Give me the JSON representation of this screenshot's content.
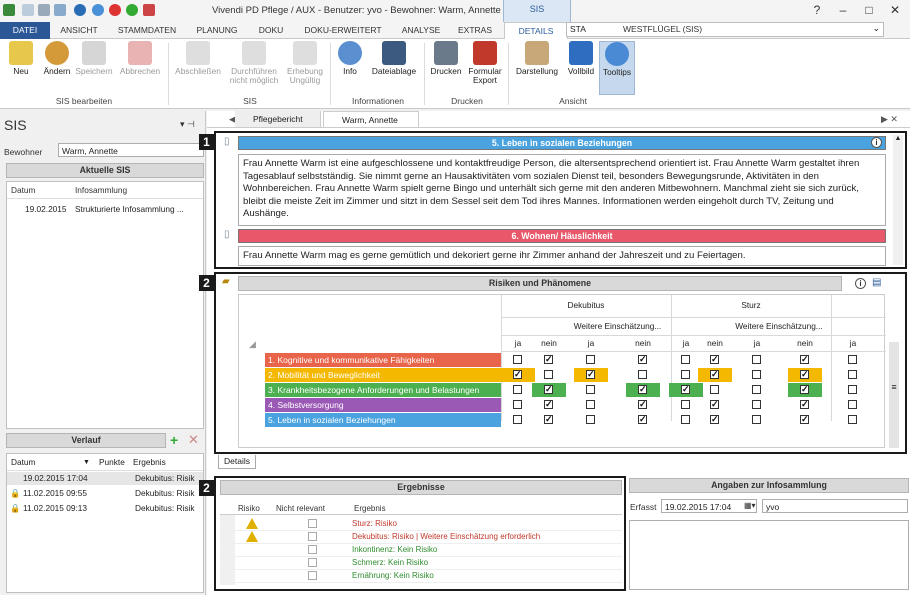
{
  "window": {
    "title": "Vivendi PD Pflege / AUX - Benutzer: yvo - Bewohner: Warm, Annette",
    "context_tab": "SIS"
  },
  "ribbon_tabs": [
    "DATEI",
    "ANSICHT",
    "STAMMDATEN",
    "PLANUNG",
    "DOKU",
    "DOKU-ERWEITERT",
    "ANALYSE",
    "EXTRAS",
    "DETAILS"
  ],
  "search": {
    "value": "STA",
    "station": "WESTFLÜGEL (SIS)"
  },
  "ribbon": {
    "buttons": [
      {
        "label": "Neu",
        "group": "sis"
      },
      {
        "label": "Ändern",
        "group": "sis"
      },
      {
        "label": "Speichern",
        "group": "sis",
        "disabled": true
      },
      {
        "label": "Abbrechen",
        "group": "sis",
        "disabled": true
      },
      {
        "label": "Abschließen",
        "group": "sis2",
        "disabled": true
      },
      {
        "label": "Durchführen nicht möglich",
        "group": "sis2",
        "disabled": true
      },
      {
        "label": "Erhebung Ungültig",
        "group": "sis2",
        "disabled": true
      },
      {
        "label": "Info",
        "group": "info"
      },
      {
        "label": "Dateiablage",
        "group": "info"
      },
      {
        "label": "Drucken",
        "group": "print"
      },
      {
        "label": "Formular Export",
        "group": "print"
      },
      {
        "label": "Darstellung",
        "group": "view"
      },
      {
        "label": "Vollbild",
        "group": "view"
      },
      {
        "label": "Tooltips",
        "group": "view"
      }
    ],
    "groups": {
      "sis": "SIS bearbeiten",
      "sis2": "SIS",
      "info": "Informationen",
      "print": "Drucken",
      "view": "Ansicht"
    }
  },
  "left": {
    "title": "SIS",
    "resident_label": "Bewohner",
    "resident_value": "Warm, Annette",
    "current_sis_head": "Aktuelle SIS",
    "cols": [
      "Datum",
      "Infosammlung"
    ],
    "sis_rows": [
      {
        "date": "19.02.2015",
        "info": "Strukturierte Infosammlung ..."
      }
    ],
    "verlauf_head": "Verlauf",
    "verlauf_cols": [
      "Datum",
      "Punkte",
      "Ergebnis"
    ],
    "verlauf_rows": [
      {
        "date": "19.02.2015 17:04",
        "points": "",
        "result": "Dekubitus: Risik"
      },
      {
        "date": "11.02.2015 09:55",
        "points": "",
        "result": "Dekubitus: Risik"
      },
      {
        "date": "11.02.2015 09:13",
        "points": "",
        "result": "Dekubitus: Risik"
      }
    ]
  },
  "doc_tabs": [
    "Pflegebericht",
    "Warm, Annette"
  ],
  "panel1": {
    "num": "1",
    "sec5_title": "5. Leben in sozialen Beziehungen",
    "sec5_text": "Frau Annette Warm ist eine aufgeschlossene und kontaktfreudige Person, die altersentsprechend orientiert ist. Frau Annette Warm gestaltet ihren Tagesablauf selbstständig. Sie nimmt gerne an Hausaktivitäten vom sozialen Dienst teil, besonders Bewegungsrunde, Aktivitäten in den Wohnbereichen. Frau Annette Warm spielt gerne Bingo und unterhält sich gerne mit den anderen Mitbewohnern. Manchmal zieht sie sich zurück, bleibt die meiste Zeit im Zimmer und sitzt in dem Sessel seit dem Tod ihres Mannes. Informationen werden eingeholt durch TV, Zeitung und Aushänge.",
    "sec6_title": "6. Wohnen/ Häuslichkeit",
    "sec6_text": "Frau Annette Warm mag es gerne gemütlich und dekoriert gerne ihr Zimmer anhand der Jahreszeit und zu Feiertagen."
  },
  "panel2": {
    "num": "2",
    "title": "Risiken und Phänomene",
    "groups": [
      "Dekubitus",
      "Sturz"
    ],
    "sub": "Weitere Einschätzung...",
    "yn": [
      "ja",
      "nein",
      "ja",
      "nein",
      "ja",
      "nein",
      "ja",
      "nein",
      "ja"
    ],
    "categories": [
      {
        "label": "1. Kognitive und kommunikative Fähigkeiten",
        "color": "#e8644a"
      },
      {
        "label": "2. Mobilität und Beweglichkeit",
        "color": "#f5b800"
      },
      {
        "label": "3. Krankheitsbezogene Anforderungen und Belastungen",
        "color": "#4caf50"
      },
      {
        "label": "4. Selbstversorgung",
        "color": "#9b59b6"
      },
      {
        "label": "5. Leben in sozialen Beziehungen",
        "color": "#4aa3df"
      }
    ],
    "checks": [
      [
        0,
        1,
        0,
        1,
        0,
        1,
        0,
        1,
        0
      ],
      [
        1,
        0,
        1,
        0,
        0,
        1,
        0,
        1,
        0
      ],
      [
        0,
        1,
        0,
        1,
        1,
        0,
        0,
        1,
        0
      ],
      [
        0,
        1,
        0,
        1,
        0,
        1,
        0,
        1,
        0
      ],
      [
        0,
        1,
        0,
        1,
        0,
        1,
        0,
        1,
        0
      ]
    ],
    "details_tab": "Details"
  },
  "panel3": {
    "num": "2",
    "title": "Ergebnisse",
    "cols": [
      "Risiko",
      "Nicht relevant",
      "Ergebnis"
    ],
    "rows": [
      {
        "warn": true,
        "text": "Sturz: Risiko",
        "color": "#c0392b"
      },
      {
        "warn": true,
        "text": "Dekubitus: Risiko | Weitere Einschätzung erforderlich",
        "color": "#c0392b"
      },
      {
        "warn": false,
        "text": "Inkontinenz: Kein Risiko",
        "color": "#2e8b2e"
      },
      {
        "warn": false,
        "text": "Schmerz: Kein Risiko",
        "color": "#2e8b2e"
      },
      {
        "warn": false,
        "text": "Ernährung: Kein Risiko",
        "color": "#2e8b2e"
      }
    ]
  },
  "info": {
    "title": "Angaben zur Infosammlung",
    "label": "Erfasst",
    "date": "19.02.2015 17:04",
    "user": "yvo"
  }
}
